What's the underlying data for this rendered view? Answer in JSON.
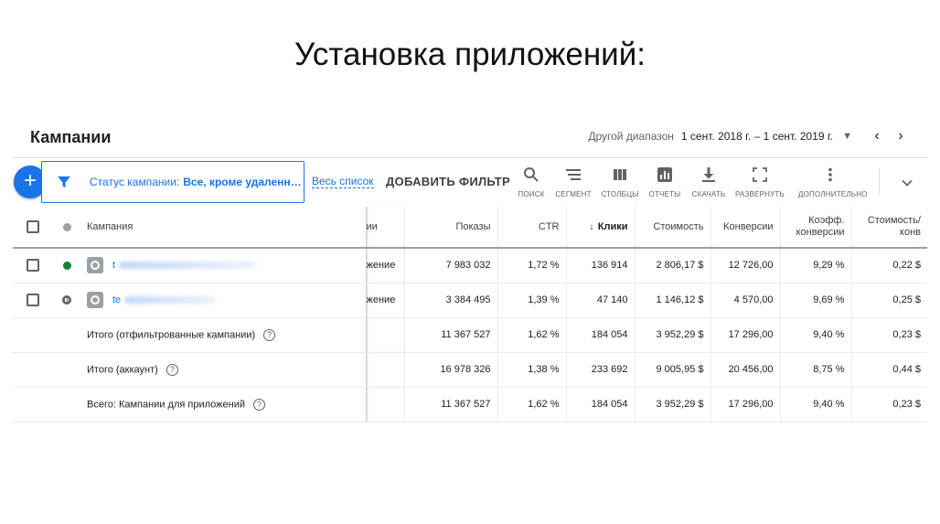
{
  "slide": {
    "title": "Установка приложений:"
  },
  "panel": {
    "title": "Кампании"
  },
  "date_range": {
    "label": "Другой диапазон",
    "value": "1 сент. 2018 г. – 1 сент. 2019 г.",
    "caret": "▼",
    "prev": "‹",
    "next": "›"
  },
  "fab": {
    "label": "+"
  },
  "filter": {
    "label": "Статус кампании:",
    "value": "Все, кроме удаленн…",
    "all_list": "Весь список",
    "add_filter": "ДОБАВИТЬ ФИЛЬТР"
  },
  "toolbar": {
    "items": [
      {
        "label": "ПОИСК",
        "icon": "search-icon"
      },
      {
        "label": "СЕГМЕНТ",
        "icon": "segment-icon"
      },
      {
        "label": "СТОЛБЦЫ",
        "icon": "columns-icon"
      },
      {
        "label": "ОТЧЕТЫ",
        "icon": "reports-icon"
      },
      {
        "label": "СКАЧАТЬ",
        "icon": "download-icon"
      },
      {
        "label": "РАЗВЕРНУТЬ",
        "icon": "expand-icon"
      },
      {
        "label": "ДОПОЛНИТЕЛЬНО",
        "icon": "more-vert-icon"
      }
    ]
  },
  "table": {
    "headers": {
      "campaign": "Кампания",
      "type": "ии",
      "impressions": "Показы",
      "ctr": "CTR",
      "sort_arrow": "↓",
      "clicks": "Клики",
      "cost": "Стоимость",
      "conversions": "Конверсии",
      "conv_rate": "Коэфф. конверсии",
      "cost_per_conv": "Стоимость/ конв"
    },
    "rows": [
      {
        "status": "enabled",
        "name_prefix": "t",
        "type": "жение",
        "impressions": "7 983 032",
        "ctr": "1,72 %",
        "clicks": "136 914",
        "cost": "2 806,17 $",
        "conversions": "12 726,00",
        "conv_rate": "9,29 %",
        "cost_per_conv": "0,22 $"
      },
      {
        "status": "paused",
        "name_prefix": "te",
        "type": "жение",
        "impressions": "3 384 495",
        "ctr": "1,39 %",
        "clicks": "47 140",
        "cost": "1 146,12 $",
        "conversions": "4 570,00",
        "conv_rate": "9,69 %",
        "cost_per_conv": "0,25 $"
      }
    ],
    "totals": [
      {
        "label": "Итого (отфильтрованные кампании)",
        "impressions": "11 367 527",
        "ctr": "1,62 %",
        "clicks": "184 054",
        "cost": "3 952,29 $",
        "conversions": "17 296,00",
        "conv_rate": "9,40 %",
        "cost_per_conv": "0,23 $"
      },
      {
        "label": "Итого (аккаунт)",
        "impressions": "16 978 326",
        "ctr": "1,38 %",
        "clicks": "233 692",
        "cost": "9 005,95 $",
        "conversions": "20 456,00",
        "conv_rate": "8,75 %",
        "cost_per_conv": "0,44 $"
      },
      {
        "label": "Всего: Кампании для приложений",
        "impressions": "11 367 527",
        "ctr": "1,62 %",
        "clicks": "184 054",
        "cost": "3 952,29 $",
        "conversions": "17 296,00",
        "conv_rate": "9,40 %",
        "cost_per_conv": "0,23 $"
      }
    ],
    "help_glyph": "?"
  },
  "colors": {
    "accent": "#1a73e8",
    "enabled": "#188038",
    "paused": "#5f6368"
  }
}
